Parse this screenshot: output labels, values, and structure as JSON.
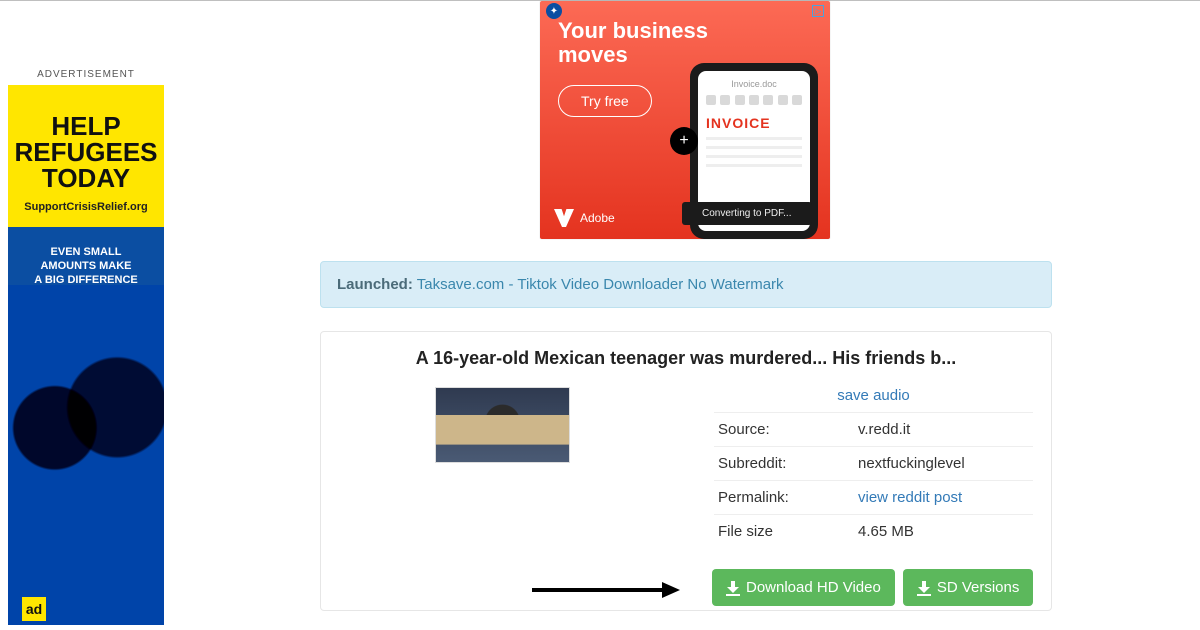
{
  "sidebar_ad": {
    "label": "ADVERTISEMENT",
    "headline1": "HELP",
    "headline2": "REFUGEES",
    "headline3": "TODAY",
    "site": "SupportCrisisRelief.org",
    "sub1": "EVEN SMALL",
    "sub2": "AMOUNTS MAKE",
    "sub3": "A BIG DIFFERENCE",
    "corner": "ad"
  },
  "top_ad": {
    "headline1": "Your business",
    "headline2": "moves",
    "cta": "Try free",
    "phone_header": "Invoice.doc",
    "phone_word": "INVOICE",
    "converting": "Converting to PDF...",
    "brand": "Adobe"
  },
  "alert": {
    "label": "Launched:",
    "link": "Taksave.com - Tiktok Video Downloader No Watermark"
  },
  "card": {
    "title": "A 16-year-old Mexican teenager was murdered... His friends b...",
    "save_audio": "save audio",
    "rows": {
      "source_label": "Source:",
      "source_value": "v.redd.it",
      "subreddit_label": "Subreddit:",
      "subreddit_value": "nextfuckinglevel",
      "permalink_label": "Permalink:",
      "permalink_value": "view reddit post",
      "filesize_label": "File size",
      "filesize_value": "4.65 MB"
    },
    "hd_button": "Download HD Video",
    "sd_button": "SD Versions"
  }
}
